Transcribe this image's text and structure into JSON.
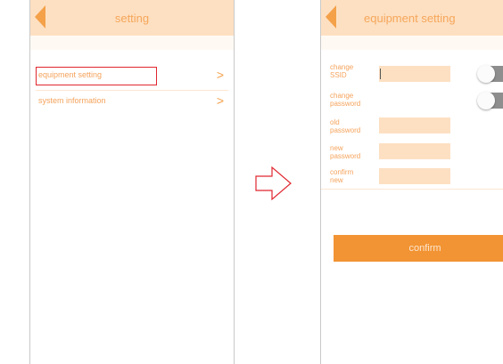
{
  "left_screen": {
    "title": "setting",
    "items": [
      {
        "label": "equipment setting",
        "chevron": ">"
      },
      {
        "label": "system information",
        "chevron": ">"
      }
    ]
  },
  "right_screen": {
    "title": "equipment setting",
    "fields": [
      {
        "label": "change\nSSID"
      },
      {
        "label": "change\npassword"
      },
      {
        "label": "old\npassword"
      },
      {
        "label": "new\npassword"
      },
      {
        "label": "confirm\nnew"
      }
    ],
    "confirm_label": "confirm"
  },
  "colors": {
    "header_bg": "#fde0c2",
    "accent": "#f4a14a",
    "button": "#f29433",
    "highlight_border": "#e0262e"
  }
}
